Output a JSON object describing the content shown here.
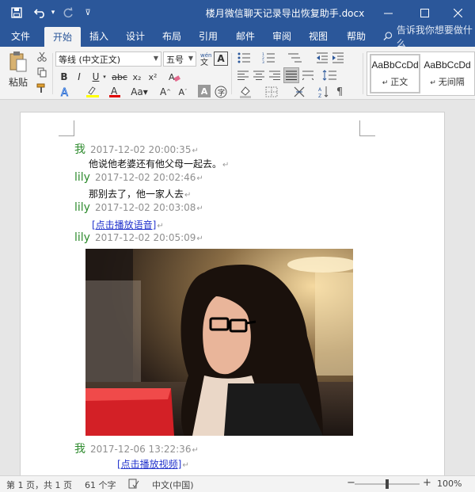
{
  "window": {
    "title": "楼月微信聊天记录导出恢复助手.docx",
    "qat": {
      "undo_arrow": "▾",
      "customize": "⊽"
    }
  },
  "menu": {
    "tabs": [
      "文件",
      "开始",
      "插入",
      "设计",
      "布局",
      "引用",
      "邮件",
      "审阅",
      "视图",
      "帮助"
    ],
    "active": "开始",
    "tell_me": "告诉我你想要做什么"
  },
  "ribbon": {
    "paste_label": "粘贴",
    "font_name": "等线 (中文正文)",
    "font_size": "五号",
    "styles": [
      {
        "sample": "AaBbCcDd",
        "name": "正文"
      },
      {
        "sample": "AaBbCcDd",
        "name": "无间隔"
      }
    ]
  },
  "document": {
    "messages": [
      {
        "sender": "我",
        "time": "2017-12-02 20:00:35",
        "content": "他说他老婆还有他父母一起去。",
        "kind": "text"
      },
      {
        "sender": "lily",
        "time": "2017-12-02 20:02:46",
        "content": "那别去了，他一家人去",
        "kind": "text"
      },
      {
        "sender": "lily",
        "time": "2017-12-02 20:03:08",
        "content": "[点击播放语音]",
        "kind": "link"
      },
      {
        "sender": "lily",
        "time": "2017-12-02 20:05:09",
        "content": "",
        "kind": "image"
      },
      {
        "sender": "我",
        "time": "2017-12-06 13:22:36",
        "content": "[点击播放视频]",
        "kind": "link"
      }
    ],
    "pilcrow": "↵"
  },
  "status": {
    "page": "第 1 页，共 1 页",
    "words": "61 个字",
    "language": "中文(中国)",
    "zoom": "100%",
    "zoom_value": 100
  },
  "colors": {
    "brand": "#2b579a",
    "sender": "#2e8b2e",
    "timestamp": "#8f8f8f",
    "link": "#2233cc"
  }
}
